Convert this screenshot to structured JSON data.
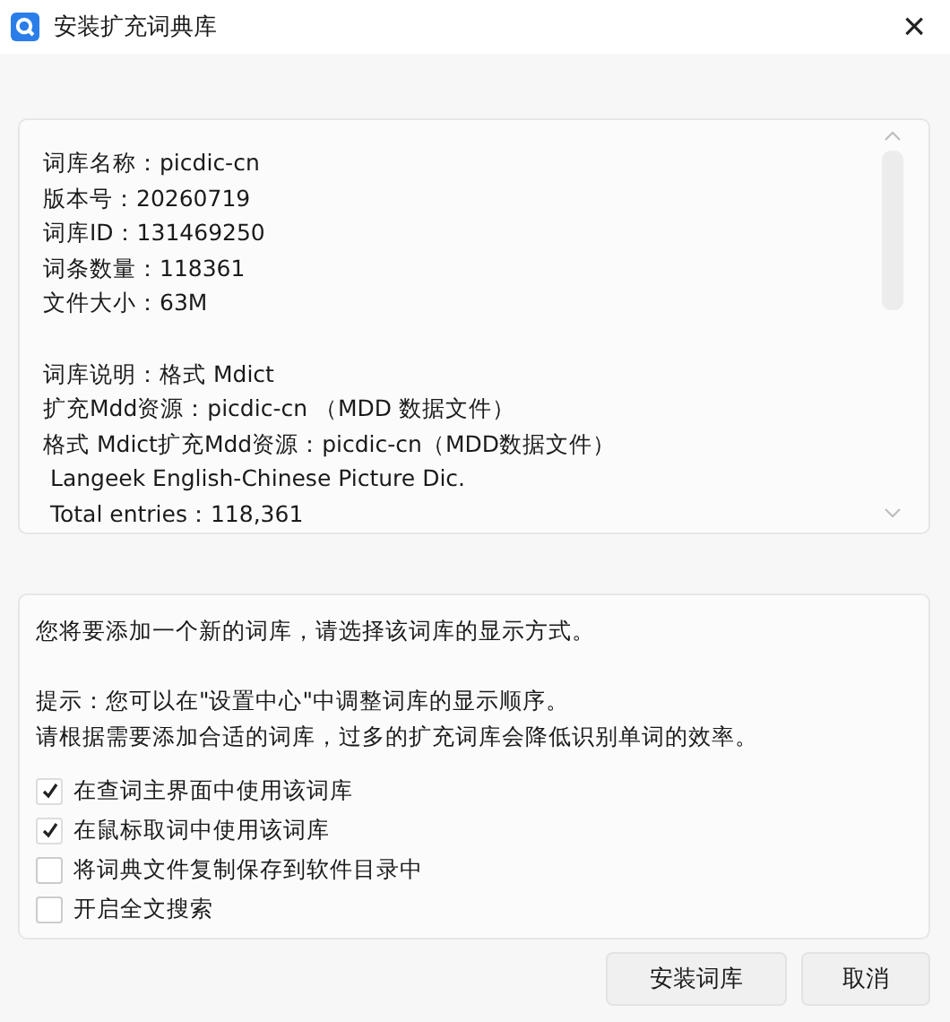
{
  "window": {
    "title": "安装扩充词典库",
    "close": "×"
  },
  "info": {
    "sections": [
      [
        "词库名称：picdic-cn",
        "版本号：20260719",
        "词库ID：131469250",
        "词条数量：118361",
        "文件大小：63M"
      ],
      [
        "词库说明：格式 Mdict",
        "扩充Mdd资源：picdic-cn （MDD 数据文件）",
        "格式 Mdict扩充Mdd资源：picdic-cn（MDD数据文件）",
        " Langeek English-Chinese Picture Dic.",
        " Total entries：118,361"
      ]
    ]
  },
  "notice": {
    "paragraphs": [
      [
        "您将要添加一个新的词库，请选择该词库的显示方式。"
      ],
      [
        "提示：您可以在\"设置中心\"中调整词库的显示顺序。",
        "请根据需要添加合适的词库，过多的扩充词库会降低识别单词的效率。"
      ]
    ]
  },
  "options": [
    {
      "label": "在查词主界面中使用该词库",
      "checked": true
    },
    {
      "label": "在鼠标取词中使用该词库",
      "checked": true
    },
    {
      "label": "将词典文件复制保存到软件目录中",
      "checked": false
    },
    {
      "label": "开启全文搜索",
      "checked": false
    }
  ],
  "buttons": [
    "安装词库",
    "取消"
  ]
}
